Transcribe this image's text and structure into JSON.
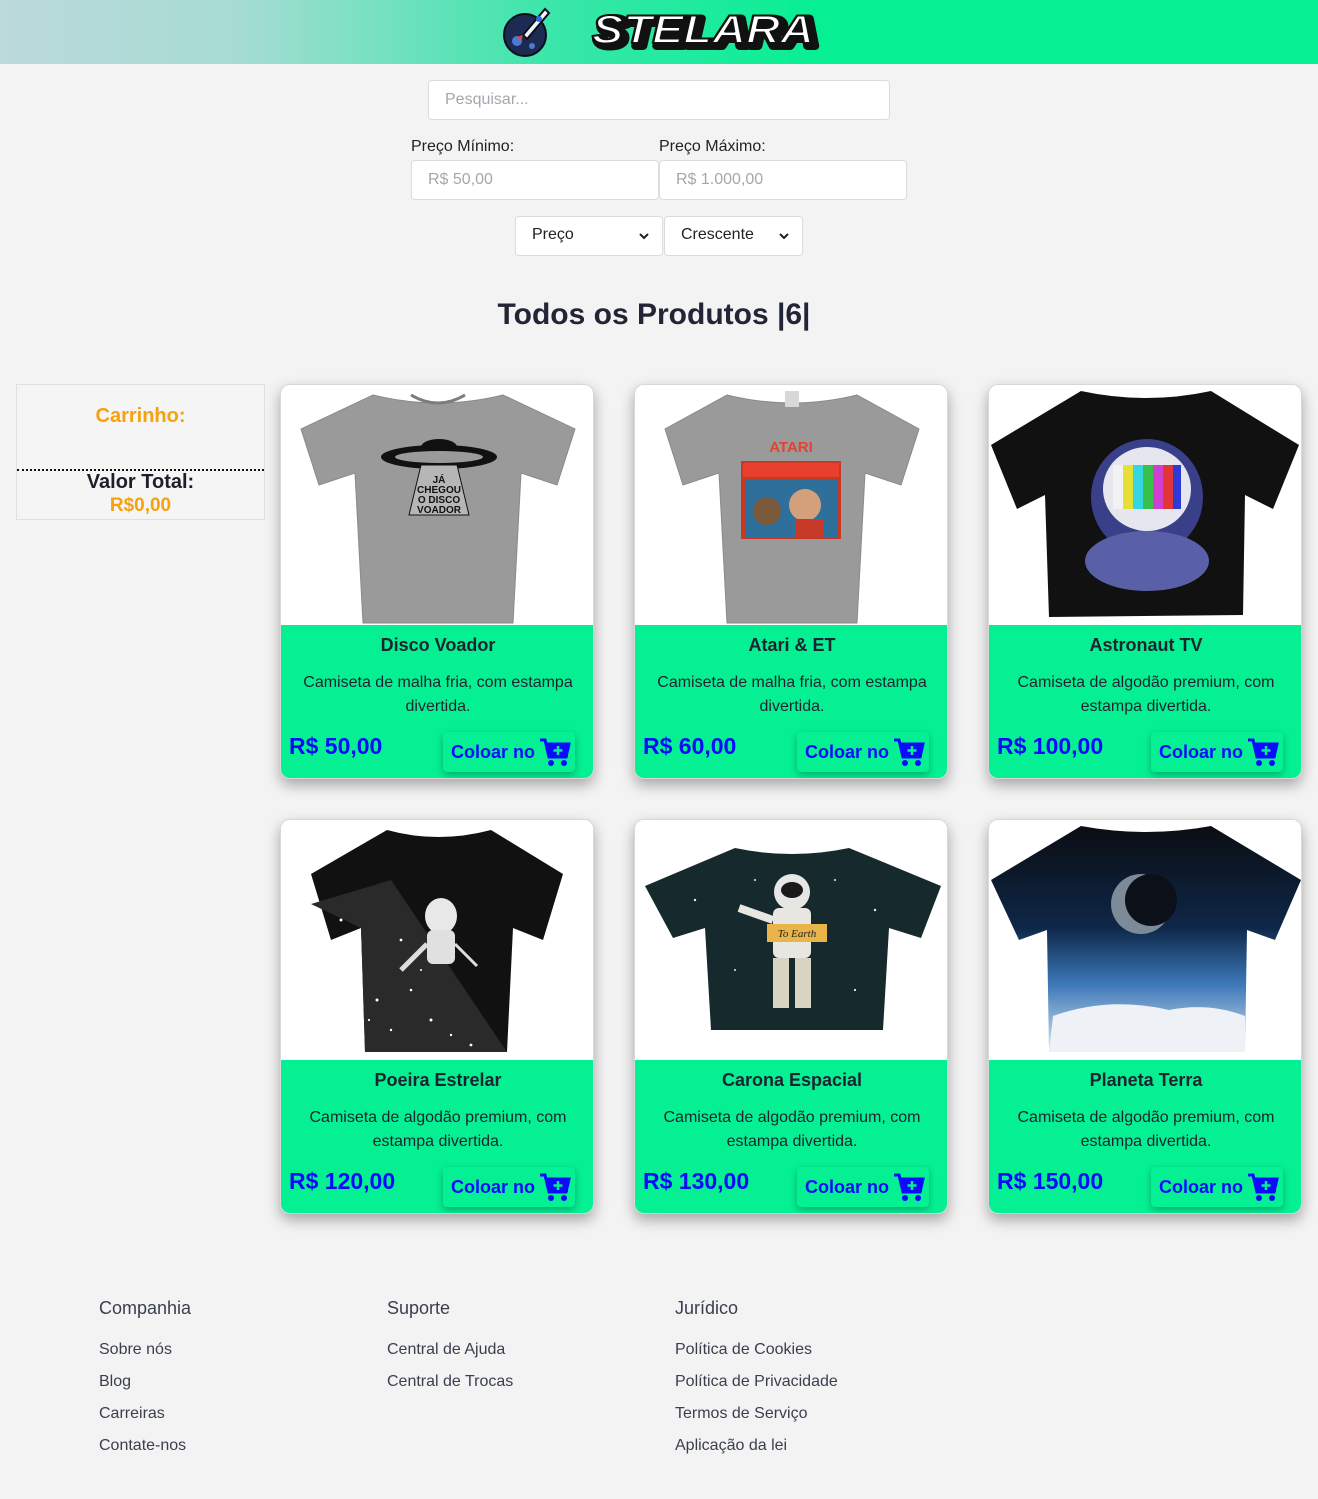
{
  "header": {
    "brand": "STELARA",
    "colors": {
      "accent": "#05f093",
      "price": "#0d0bff",
      "cart": "#f7a10c"
    }
  },
  "filters": {
    "search_placeholder": "Pesquisar...",
    "min_label": "Preço Mínimo:",
    "min_placeholder": "R$ 50,00",
    "max_label": "Preço Máximo:",
    "max_placeholder": "R$ 1.000,00",
    "sort_field": "Preço",
    "sort_order": "Crescente"
  },
  "page_title": "Todos os Produtos |6|",
  "cart": {
    "title": "Carrinho:",
    "total_label": "Valor Total:",
    "total_value": "R$0,00"
  },
  "products": [
    {
      "name": "Disco Voador",
      "desc": "Camiseta de malha fria, com estampa divertida.",
      "price": "R$ 50,00",
      "button": "Coloar no",
      "icon": "ufo-shirt"
    },
    {
      "name": "Atari & ET",
      "desc": "Camiseta de malha fria, com estampa divertida.",
      "price": "R$ 60,00",
      "button": "Coloar no",
      "icon": "atari-shirt"
    },
    {
      "name": "Astronaut TV",
      "desc": "Camiseta de algodão premium, com estampa divertida.",
      "price": "R$ 100,00",
      "button": "Coloar no",
      "icon": "astronaut-tv-shirt"
    },
    {
      "name": "Poeira Estrelar",
      "desc": "Camiseta de algodão premium, com estampa divertida.",
      "price": "R$ 120,00",
      "button": "Coloar no",
      "icon": "stardust-shirt"
    },
    {
      "name": "Carona Espacial",
      "desc": "Camiseta de algodão premium, com estampa divertida.",
      "price": "R$ 130,00",
      "button": "Coloar no",
      "icon": "hitchhiker-shirt"
    },
    {
      "name": "Planeta Terra",
      "desc": "Camiseta de algodão premium, com estampa divertida.",
      "price": "R$ 150,00",
      "button": "Coloar no",
      "icon": "earth-shirt"
    }
  ],
  "footer": {
    "columns": [
      {
        "title": "Companhia",
        "links": [
          "Sobre nós",
          "Blog",
          "Carreiras",
          "Contate-nos"
        ]
      },
      {
        "title": "Suporte",
        "links": [
          "Central de Ajuda",
          "Central de Trocas"
        ]
      },
      {
        "title": "Jurídico",
        "links": [
          "Política de Cookies",
          "Política de Privacidade",
          "Termos de Serviço",
          "Aplicação da lei"
        ]
      }
    ]
  }
}
